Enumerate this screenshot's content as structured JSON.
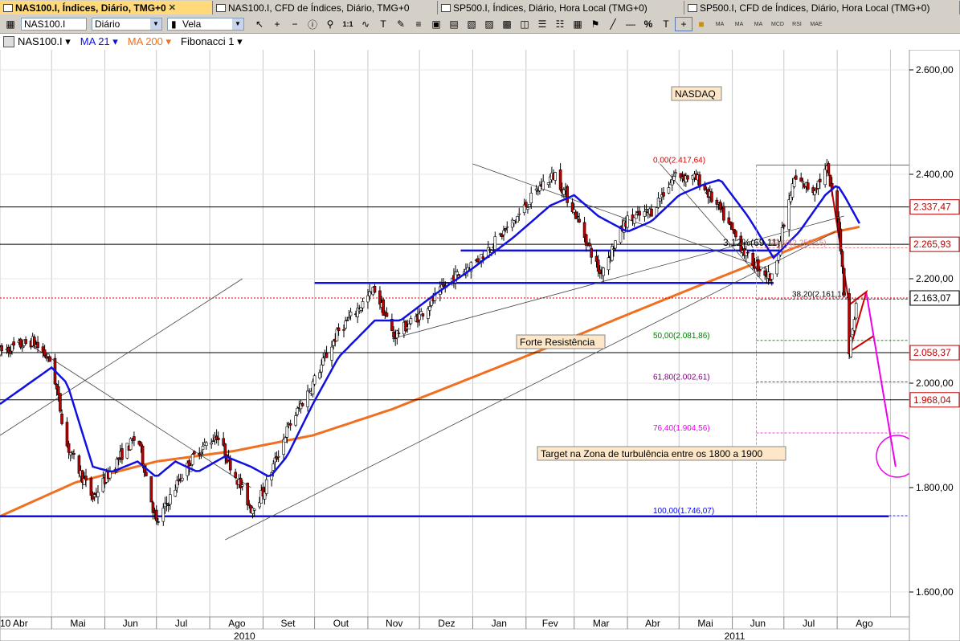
{
  "tabs": [
    {
      "label": "NAS100.I, Índices, Diário, TMG+0",
      "active": true,
      "closable": true
    },
    {
      "label": "NAS100.I, CFD de Índices, Diário, TMG+0",
      "active": false
    },
    {
      "label": "SP500.I, Índices, Diário, Hora Local (TMG+0)",
      "active": false
    },
    {
      "label": "SP500.I, CFD de Índices, Diário, Hora Local (TMG+0)",
      "active": false
    }
  ],
  "toolbar": {
    "symbol": "NAS100.I",
    "period": "Diário",
    "chart_style": "Vela",
    "zoom_label": "1:1",
    "percent_label": "%",
    "small_buttons": [
      "MA",
      "MA",
      "MA",
      "MCD",
      "RSI",
      "MAE"
    ]
  },
  "legend": {
    "symbol": "NAS100.I",
    "ma21": "MA 21",
    "ma200": "MA 200",
    "fib": "Fibonacci 1"
  },
  "colors": {
    "ma21": "#1010e0",
    "ma200": "#f07020",
    "fib_red": "#c00000",
    "magenta": "#ee00ee"
  },
  "chart_data": {
    "type": "candlestick",
    "title": "NASDAQ",
    "ylim": [
      1500,
      2640
    ],
    "y_ticks": [
      1600,
      1800,
      2000,
      2200,
      2400,
      2600
    ],
    "y_tick_labels": [
      "1.600,00",
      "1.800,00",
      "2.000,00",
      "2.200,00",
      "2.400,00",
      "2.600,00"
    ],
    "x_months": [
      "10 Abr",
      "Mai",
      "Jun",
      "Jul",
      "Ago",
      "Set",
      "Out",
      "Nov",
      "Dez",
      "Jan",
      "Fev",
      "Mar",
      "Abr",
      "Mai",
      "Jun",
      "Jul",
      "Ago"
    ],
    "x_years": [
      "2010",
      "2011"
    ],
    "price_key": [
      [
        "2010-04-01",
        2060
      ],
      [
        "2010-04-20",
        2080
      ],
      [
        "2010-05-01",
        2040
      ],
      [
        "2010-05-10",
        1880
      ],
      [
        "2010-05-25",
        1780
      ],
      [
        "2010-06-10",
        1860
      ],
      [
        "2010-06-20",
        1900
      ],
      [
        "2010-07-01",
        1730
      ],
      [
        "2010-07-15",
        1820
      ],
      [
        "2010-07-25",
        1870
      ],
      [
        "2010-08-05",
        1900
      ],
      [
        "2010-08-25",
        1760
      ],
      [
        "2010-09-01",
        1790
      ],
      [
        "2010-09-15",
        1910
      ],
      [
        "2010-09-30",
        2000
      ],
      [
        "2010-10-15",
        2100
      ],
      [
        "2010-11-05",
        2180
      ],
      [
        "2010-11-16",
        2090
      ],
      [
        "2010-12-01",
        2130
      ],
      [
        "2010-12-20",
        2200
      ],
      [
        "2011-01-05",
        2240
      ],
      [
        "2011-01-25",
        2310
      ],
      [
        "2011-02-10",
        2380
      ],
      [
        "2011-02-18",
        2400
      ],
      [
        "2011-03-01",
        2330
      ],
      [
        "2011-03-16",
        2210
      ],
      [
        "2011-03-31",
        2310
      ],
      [
        "2011-04-15",
        2330
      ],
      [
        "2011-04-29",
        2400
      ],
      [
        "2011-05-12",
        2390
      ],
      [
        "2011-05-25",
        2330
      ],
      [
        "2011-06-10",
        2240
      ],
      [
        "2011-06-24",
        2200
      ],
      [
        "2011-07-07",
        2390
      ],
      [
        "2011-07-18",
        2370
      ],
      [
        "2011-07-26",
        2410
      ],
      [
        "2011-08-02",
        2300
      ],
      [
        "2011-08-08",
        2060
      ],
      [
        "2011-08-12",
        2150
      ]
    ],
    "ma21_key": [
      [
        "2010-04-01",
        1960
      ],
      [
        "2010-05-01",
        2030
      ],
      [
        "2010-05-10",
        2000
      ],
      [
        "2010-05-25",
        1840
      ],
      [
        "2010-06-05",
        1830
      ],
      [
        "2010-06-20",
        1850
      ],
      [
        "2010-07-01",
        1820
      ],
      [
        "2010-07-12",
        1850
      ],
      [
        "2010-07-25",
        1830
      ],
      [
        "2010-08-10",
        1860
      ],
      [
        "2010-08-25",
        1840
      ],
      [
        "2010-09-05",
        1820
      ],
      [
        "2010-09-15",
        1860
      ],
      [
        "2010-09-30",
        1960
      ],
      [
        "2010-10-15",
        2050
      ],
      [
        "2010-11-05",
        2120
      ],
      [
        "2010-11-20",
        2120
      ],
      [
        "2010-12-10",
        2170
      ],
      [
        "2011-01-01",
        2220
      ],
      [
        "2011-01-25",
        2280
      ],
      [
        "2011-02-15",
        2340
      ],
      [
        "2011-03-01",
        2360
      ],
      [
        "2011-03-15",
        2320
      ],
      [
        "2011-04-01",
        2290
      ],
      [
        "2011-04-15",
        2310
      ],
      [
        "2011-05-01",
        2360
      ],
      [
        "2011-05-15",
        2380
      ],
      [
        "2011-05-25",
        2390
      ],
      [
        "2011-06-10",
        2320
      ],
      [
        "2011-06-25",
        2240
      ],
      [
        "2011-07-10",
        2290
      ],
      [
        "2011-07-25",
        2360
      ],
      [
        "2011-08-01",
        2380
      ],
      [
        "2011-08-05",
        2360
      ],
      [
        "2011-08-15",
        2300
      ]
    ],
    "ma200_key": [
      [
        "2010-04-01",
        1745
      ],
      [
        "2010-05-15",
        1810
      ],
      [
        "2010-07-01",
        1850
      ],
      [
        "2010-08-15",
        1870
      ],
      [
        "2010-09-30",
        1900
      ],
      [
        "2010-11-15",
        1950
      ],
      [
        "2010-12-31",
        2010
      ],
      [
        "2011-02-15",
        2070
      ],
      [
        "2011-03-31",
        2130
      ],
      [
        "2011-05-15",
        2190
      ],
      [
        "2011-06-30",
        2250
      ],
      [
        "2011-07-31",
        2290
      ],
      [
        "2011-08-15",
        2300
      ]
    ],
    "levels": [
      {
        "value": 2337.47,
        "label": "2.337,47",
        "color": "#c00000"
      },
      {
        "value": 2265.93,
        "label": "2.265,93",
        "color": "#c00000"
      },
      {
        "value": 2163.07,
        "label": "2.163,07",
        "color": "#000000"
      },
      {
        "value": 2058.37,
        "label": "2.058,37",
        "color": "#c00000"
      },
      {
        "value": 1968.04,
        "label": "1.968,04",
        "color": "#c00000"
      }
    ],
    "fibonacci": [
      {
        "label": "0,00(2.417,64)",
        "value": 2417.64,
        "color": "#d00000"
      },
      {
        "label": "23,60(2.259,15)",
        "value": 2259.15,
        "color": "#e08080"
      },
      {
        "label": "38,20(2.161,10)",
        "value": 2161.1,
        "color": "#000000"
      },
      {
        "label": "50,00(2.081,86)",
        "value": 2081.86,
        "color": "#008000"
      },
      {
        "label": "61,80(2.002,61)",
        "value": 2002.61,
        "color": "#800080"
      },
      {
        "label": "76,40(1.904,56)",
        "value": 1904.56,
        "color": "#ee00ee"
      },
      {
        "label": "100,00(1.746,07)",
        "value": 1746.07,
        "color": "#0000ff"
      }
    ],
    "annotations": {
      "title_box": "NASDAQ",
      "forte": "Forte Resistência",
      "target": "Target na Zona de turbulência entre os 1800 a 1900",
      "retracement": "3,12%(69,11)"
    },
    "support_lines": [
      {
        "from": "2010-10-01",
        "to": "2011-06-25",
        "value": 2192
      },
      {
        "from": "2010-12-25",
        "to": "2011-06-30",
        "value": 2254
      },
      {
        "from": "2010-04-01",
        "to": "2011-08-31",
        "value": 1745
      }
    ]
  }
}
